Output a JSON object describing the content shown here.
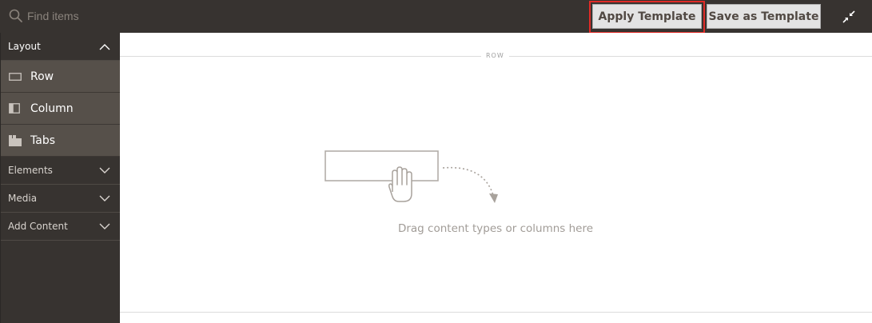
{
  "search": {
    "placeholder": "Find items"
  },
  "toolbar": {
    "apply_label": "Apply Template",
    "save_label": "Save as Template",
    "fullscreen_icon": "collapse-arrows-icon"
  },
  "sidebar": {
    "layout": {
      "label": "Layout",
      "expanded": true,
      "items": [
        {
          "label": "Row",
          "icon": "row-icon"
        },
        {
          "label": "Column",
          "icon": "column-icon"
        },
        {
          "label": "Tabs",
          "icon": "tabs-icon"
        }
      ]
    },
    "sections": [
      {
        "label": "Elements",
        "expanded": false
      },
      {
        "label": "Media",
        "expanded": false
      },
      {
        "label": "Add Content",
        "expanded": false
      }
    ]
  },
  "stage": {
    "row_label": "ROW",
    "drop_hint": "Drag content types or columns here"
  },
  "colors": {
    "topbar": "#373330",
    "sidebar_item": "#56504a",
    "highlight": "#e02b27"
  }
}
